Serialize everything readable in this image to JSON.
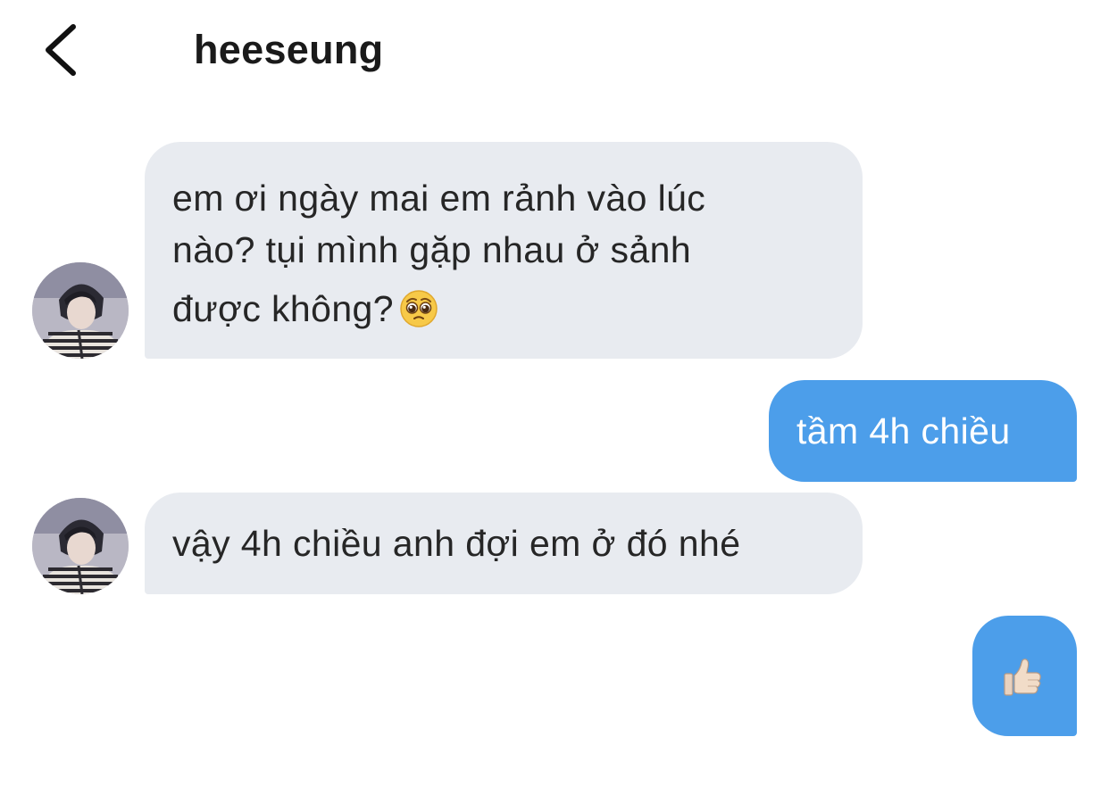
{
  "header": {
    "title": "heeseung"
  },
  "messages": [
    {
      "sender": "heeseung",
      "direction": "incoming",
      "lines": [
        "em ơi ngày mai em rảnh vào lúc",
        "nào? tụi mình gặp nhau ở sảnh",
        "được không?"
      ],
      "emoji": "pleading-face"
    },
    {
      "sender": "me",
      "direction": "outgoing",
      "text": "tầm 4h chiều"
    },
    {
      "sender": "heeseung",
      "direction": "incoming",
      "text": "vậy 4h chiều anh đợi em ở đó nhé"
    },
    {
      "sender": "me",
      "direction": "outgoing",
      "emoji": "thumbs-up"
    }
  ],
  "colors": {
    "incoming_bubble": "#e8ebf0",
    "outgoing_bubble": "#4c9eea",
    "outgoing_text": "#ffffff",
    "text": "#262626"
  }
}
